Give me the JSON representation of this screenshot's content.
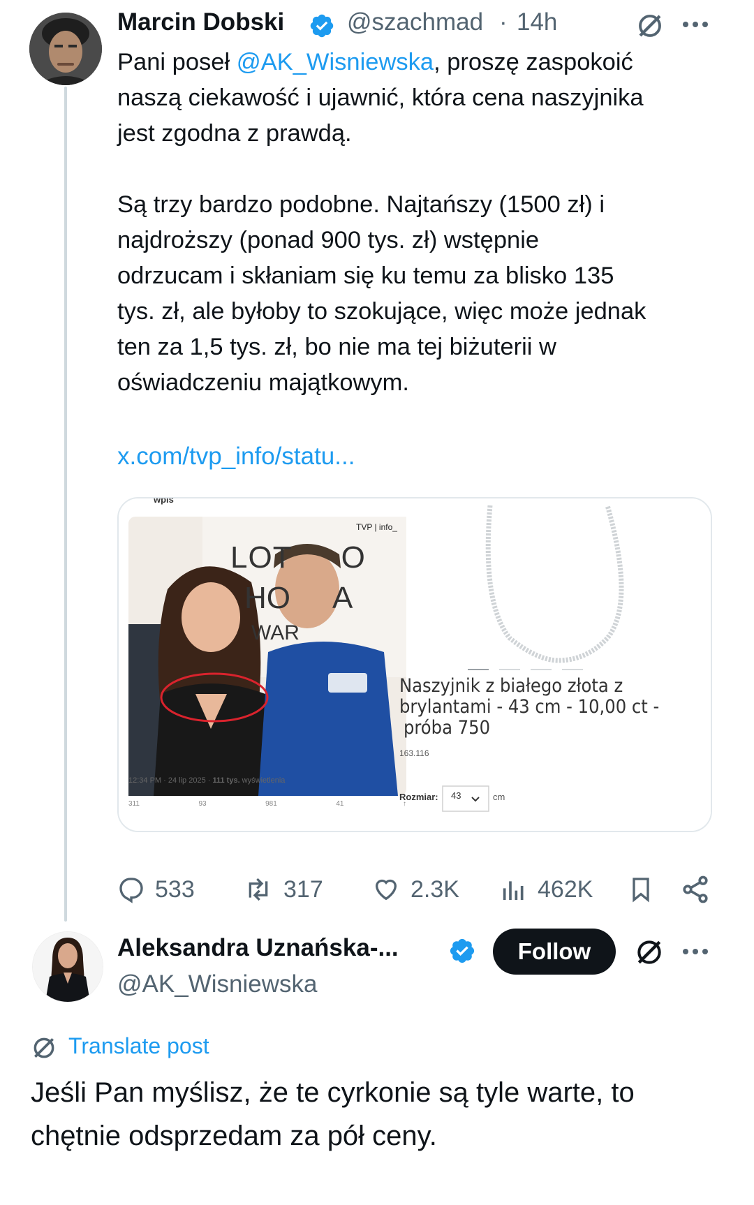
{
  "tweet1": {
    "author_name": "Marcin Dobski",
    "handle": "@szachmad",
    "separator": "·",
    "time": "14h",
    "text_prefix": "Pani poseł ",
    "mention": "@AK_Wisniewska",
    "text_line1_rest": ", proszę zaspokoić",
    "text_line2": "naszą ciekawość i ujawnić, która cena naszyjnika",
    "text_line3": "jest zgodna z prawdą.",
    "para2_line1": "Są trzy bardzo podobne. Najtańszy (1500 zł) i",
    "para2_line2": "najdroższy (ponad 900 tys. zł) wstępnie",
    "para2_line3": "odrzucam i skłaniam się ku temu za blisko 135",
    "para2_line4": "tys. zł, ale byłoby to szokujące, więc może jednak",
    "para2_line5": "ten za 1,5 tys. zł, bo nie ma tej biżuterii w",
    "para2_line6": "oświadczeniu majątkowym.",
    "link": "x.com/tvp_info/statu...",
    "stats": {
      "replies": "533",
      "reposts": "317",
      "likes": "2.3K",
      "views": "462K"
    },
    "card": {
      "left": {
        "header": "wpis",
        "tvp_logo": "TVP | info_",
        "sign_line1": "LOT",
        "sign_line1b": "O",
        "sign_line2": "HO",
        "sign_line2b": "A",
        "sign_line3": "WAR",
        "footer_time": "12:34 PM · 24 lip 2025 · ",
        "footer_views": "111 tys.",
        "footer_views_label": " wyświetlenia",
        "mini_replies": "311",
        "mini_reposts": "93",
        "mini_likes": "981",
        "mini_bookmarks": "41"
      },
      "right": {
        "product_line1": "Naszyjnik z białego złota z",
        "product_line2": "brylantami - 43 cm - 10,00 ct -",
        "product_line3": "próba 750",
        "product_code": "163.116",
        "size_label": "Rozmiar:",
        "size_value": "43",
        "size_unit": "cm"
      }
    }
  },
  "tweet2": {
    "author_name": "Aleksandra Uznańska-...",
    "handle": "@AK_Wisniewska",
    "follow_label": "Follow",
    "translate_label": "Translate post",
    "text_line1": "Jeśli Pan myślisz, że te cyrkonie są tyle warte, to",
    "text_line2": "chętnie odsprzedam za pół ceny."
  },
  "colors": {
    "accent": "#1d9bf0",
    "text": "#0f1419",
    "secondary": "#536471",
    "border": "#cfd9de"
  }
}
